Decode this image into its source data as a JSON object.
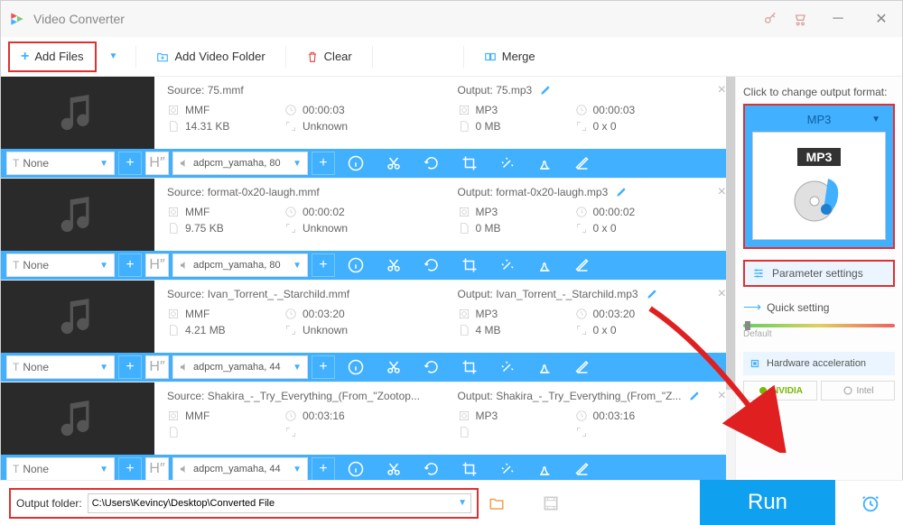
{
  "app": {
    "title": "Video Converter"
  },
  "toolbar": {
    "add_files": "Add Files",
    "add_folder": "Add Video Folder",
    "clear": "Clear",
    "merge": "Merge"
  },
  "files": [
    {
      "source_label": "Source: 75.mmf",
      "src_fmt": "MMF",
      "src_dur": "00:00:03",
      "src_size": "14.31 KB",
      "src_dim": "Unknown",
      "output_label": "Output: 75.mp3",
      "out_fmt": "MP3",
      "out_dur": "00:00:03",
      "out_size": "0 MB",
      "out_dim": "0 x 0",
      "subtitle": "None",
      "audio": "adpcm_yamaha, 80"
    },
    {
      "source_label": "Source: format-0x20-laugh.mmf",
      "src_fmt": "MMF",
      "src_dur": "00:00:02",
      "src_size": "9.75 KB",
      "src_dim": "Unknown",
      "output_label": "Output: format-0x20-laugh.mp3",
      "out_fmt": "MP3",
      "out_dur": "00:00:02",
      "out_size": "0 MB",
      "out_dim": "0 x 0",
      "subtitle": "None",
      "audio": "adpcm_yamaha, 80"
    },
    {
      "source_label": "Source: Ivan_Torrent_-_Starchild.mmf",
      "src_fmt": "MMF",
      "src_dur": "00:03:20",
      "src_size": "4.21 MB",
      "src_dim": "Unknown",
      "output_label": "Output: Ivan_Torrent_-_Starchild.mp3",
      "out_fmt": "MP3",
      "out_dur": "00:03:20",
      "out_size": "4 MB",
      "out_dim": "0 x 0",
      "subtitle": "None",
      "audio": "adpcm_yamaha, 44"
    },
    {
      "source_label": "Source: Shakira_-_Try_Everything_(From_\"Zootop...",
      "src_fmt": "MMF",
      "src_dur": "00:03:16",
      "src_size": "",
      "src_dim": "",
      "output_label": "Output: Shakira_-_Try_Everything_(From_\"Z...",
      "out_fmt": "MP3",
      "out_dur": "00:03:16",
      "out_size": "",
      "out_dim": "",
      "subtitle": "None",
      "audio": "adpcm_yamaha, 44"
    }
  ],
  "sidebar": {
    "change_label": "Click to change output format:",
    "format": "MP3",
    "format_badge": "MP3",
    "param": "Parameter settings",
    "quick": "Quick setting",
    "slider_label": "Default",
    "hw": "Hardware acceleration",
    "nvidia": "NVIDIA",
    "intel": "Intel"
  },
  "bottom": {
    "out_folder_label": "Output folder:",
    "out_folder_path": "C:\\Users\\Kevincy\\Desktop\\Converted File",
    "run": "Run"
  }
}
